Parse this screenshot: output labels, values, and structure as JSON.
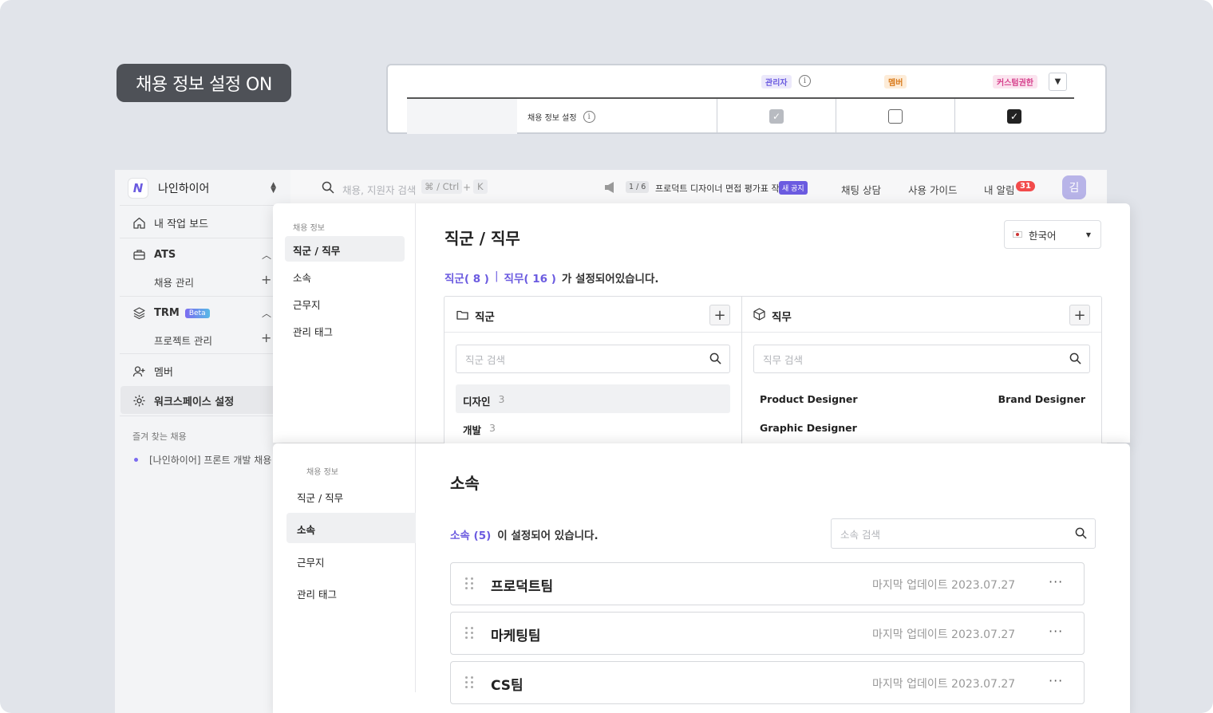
{
  "pill": {
    "label": "채용 정보 설정 ON"
  },
  "permissions": {
    "roles": [
      {
        "label": "관리자",
        "bg": "#ece9fb",
        "color": "#6b5be0"
      },
      {
        "label": "멤버",
        "bg": "#fdecd8",
        "color": "#d97b1d"
      },
      {
        "label": "커스텀권한",
        "bg": "#fbe4ef",
        "color": "#d6408c"
      }
    ],
    "row_label": "채용 정보 설정",
    "checks": [
      {
        "role": "관리자",
        "checked": true,
        "disabled": true
      },
      {
        "role": "멤버",
        "checked": false,
        "disabled": false
      },
      {
        "role": "커스텀권한",
        "checked": true,
        "disabled": false
      }
    ]
  },
  "workspace": {
    "name": "나인하이어"
  },
  "sidebar": {
    "dashboard": "내 작업 보드",
    "ats": "ATS",
    "ats_sub": "채용 관리",
    "trm": "TRM",
    "trm_badge": "Beta",
    "trm_sub": "프로젝트 관리",
    "member": "멤버",
    "workspace_settings": "워크스페이스 설정",
    "fav_title": "즐겨 찾는 채용",
    "fav_item": "[나인하이어] 프론트 개발 채용"
  },
  "topbar": {
    "search_placeholder": "채용, 지원자 검색",
    "shortcut": "⌘ / Ctrl",
    "shortcut_plus": "+",
    "shortcut_key": "K",
    "notice_counter": "1 / 6",
    "notice_text": "프로덕트 디자이너 면접 평가표 작...",
    "notice_badge": "새 공지",
    "chat": "채팅 상담",
    "guide": "사용 가이드",
    "alerts": "내 알림",
    "alerts_count": "31",
    "avatar": "김"
  },
  "panel1": {
    "nav_title": "채용 정보",
    "nav": [
      "직군 / 직무",
      "소속",
      "근무지",
      "관리 태그"
    ],
    "title": "직군 / 직무",
    "lang": "한국어",
    "summary_group": "직군( 8 )",
    "summary_sep": "|",
    "summary_job": "직무( 16 )",
    "summary_rest": "가 설정되어있습니다.",
    "group_col": {
      "title": "직군",
      "search_placeholder": "직군 검색",
      "items": [
        {
          "name": "디자인",
          "count": "3"
        },
        {
          "name": "개발",
          "count": "3"
        }
      ]
    },
    "job_col": {
      "title": "직무",
      "search_placeholder": "직무 검색",
      "items": [
        "Product Designer",
        "Brand Designer",
        "Graphic Designer"
      ]
    }
  },
  "panel2": {
    "nav_title": "채용 정보",
    "nav": [
      "직군 / 직무",
      "소속",
      "근무지",
      "관리 태그"
    ],
    "title": "소속",
    "summary_count": "소속 (5)",
    "summary_rest": "이 설정되어 있습니다.",
    "search_placeholder": "소속 검색",
    "rows": [
      {
        "name": "프로덕트팀",
        "updated": "마지막 업데이트 2023.07.27"
      },
      {
        "name": "마케팅팀",
        "updated": "마지막 업데이트 2023.07.27"
      },
      {
        "name": "CS팀",
        "updated": "마지막 업데이트 2023.07.27"
      }
    ]
  },
  "colors": {
    "accent": "#6b5be0",
    "alert": "#f24b4b"
  }
}
